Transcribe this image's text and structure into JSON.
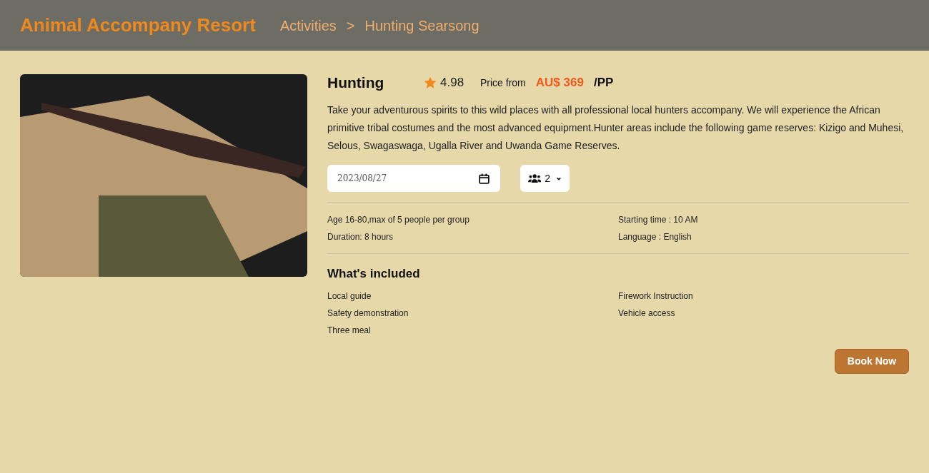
{
  "header": {
    "brand": "Animal Accompany Resort",
    "breadcrumb": [
      "Activities",
      "Hunting Searsong"
    ],
    "separator": ">"
  },
  "activity": {
    "title": "Hunting",
    "rating": "4.98",
    "price_label": "Price from",
    "price": "AU$ 369",
    "price_unit": "/PP",
    "description": "Take your adventurous spirits to this wild places with all professional local hunters accompany. We will experience the African primitive tribal costumes and the most advanced equipment.Hunter areas include the following game reserves: Kizigo and Muhesi, Selous, Swagaswaga, Ugalla River and Uwanda Game Reserves.",
    "date": {
      "value": "2023/08/27"
    },
    "people": {
      "value": "2"
    },
    "details": [
      "Age 16-80,max of 5 people per group",
      "Starting time : 10 AM",
      "Duration: 8 hours",
      "Language : English"
    ],
    "included_title": "What's included",
    "included": [
      "Local guide",
      "Firework Instruction",
      "Safety demonstration",
      "Vehicle access",
      "Three meal"
    ],
    "book_button": "Book Now"
  }
}
